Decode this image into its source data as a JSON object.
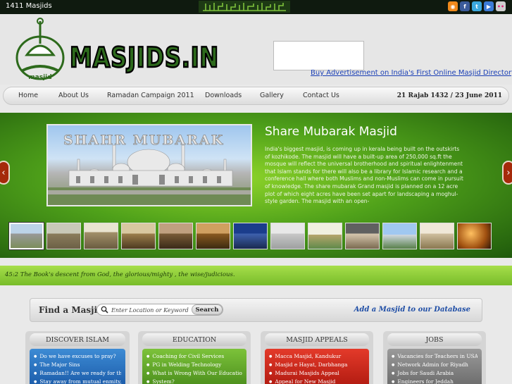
{
  "topbar": {
    "masjid_count": "1411 Masjids",
    "social": [
      "rss-icon",
      "facebook-icon",
      "twitter-icon",
      "youtube-icon",
      "flickr-icon"
    ]
  },
  "header": {
    "logo_text": "MASJIDS.IN",
    "ad_link": "Buy Advertisement on India's First Online Masjid Directory"
  },
  "nav": {
    "items": [
      "Home",
      "About Us",
      "Ramadan Campaign 2011",
      "Downloads",
      "Gallery",
      "Contact Us"
    ],
    "date": "21 Rajab 1432 / 23 June 2011"
  },
  "slider": {
    "banner_text": "SHAHR MUBARAK",
    "title": "Share Mubarak Masjid",
    "description": "India's biggest masjid, is coming up in kerala being built on the outskirts of kozhikode. The masjid will have a built-up area of 250,000 sq.ft the mosque will reflect the universal brotherhood and spiritual enlightenment that Islam stands for there will also be a library for Islamic research and a conference hall where both Muslims and non-Muslims can come in pursuit of knowledge. The share mubarak Grand masjid is planned on a 12 acre plot of which eight acres have been set apart for landscaping a moghul-style garden. The masjid with an open-",
    "thumbnail_count": 13
  },
  "quote": "45:2 The Book's descent from God, the glorious/mighty , the wise/judicious.",
  "find": {
    "label": "Find a Masjid",
    "placeholder": "Enter Location or Keyword",
    "search_label": "Search",
    "add_link": "Add a Masjid to our Database"
  },
  "boxes": [
    {
      "title": "DISCOVER ISLAM",
      "items": [
        "Do we have excuses to pray?",
        "The Major Sins",
        "Ramadan!! Are we ready for that?",
        "Stay away from mutual enmity, it"
      ]
    },
    {
      "title": "EDUCATION",
      "items": [
        "Coaching for Civil Services",
        "PG in Welding Technology",
        "What is Wrong With Our Education",
        "System?"
      ]
    },
    {
      "title": "MASJID APPEALS",
      "items": [
        "Macca Masjid, Kandukur",
        "Masjid e Hayat, Darbhanga",
        "Madurai Masjids Appeal",
        "Appeal for New Masjid"
      ]
    },
    {
      "title": "JOBS",
      "items": [
        "Vacancies for Teachers in USA",
        "Network Admin for Riyadh",
        "Jobs for Saudi Arabia",
        "Engineers for Jeddah"
      ]
    }
  ]
}
